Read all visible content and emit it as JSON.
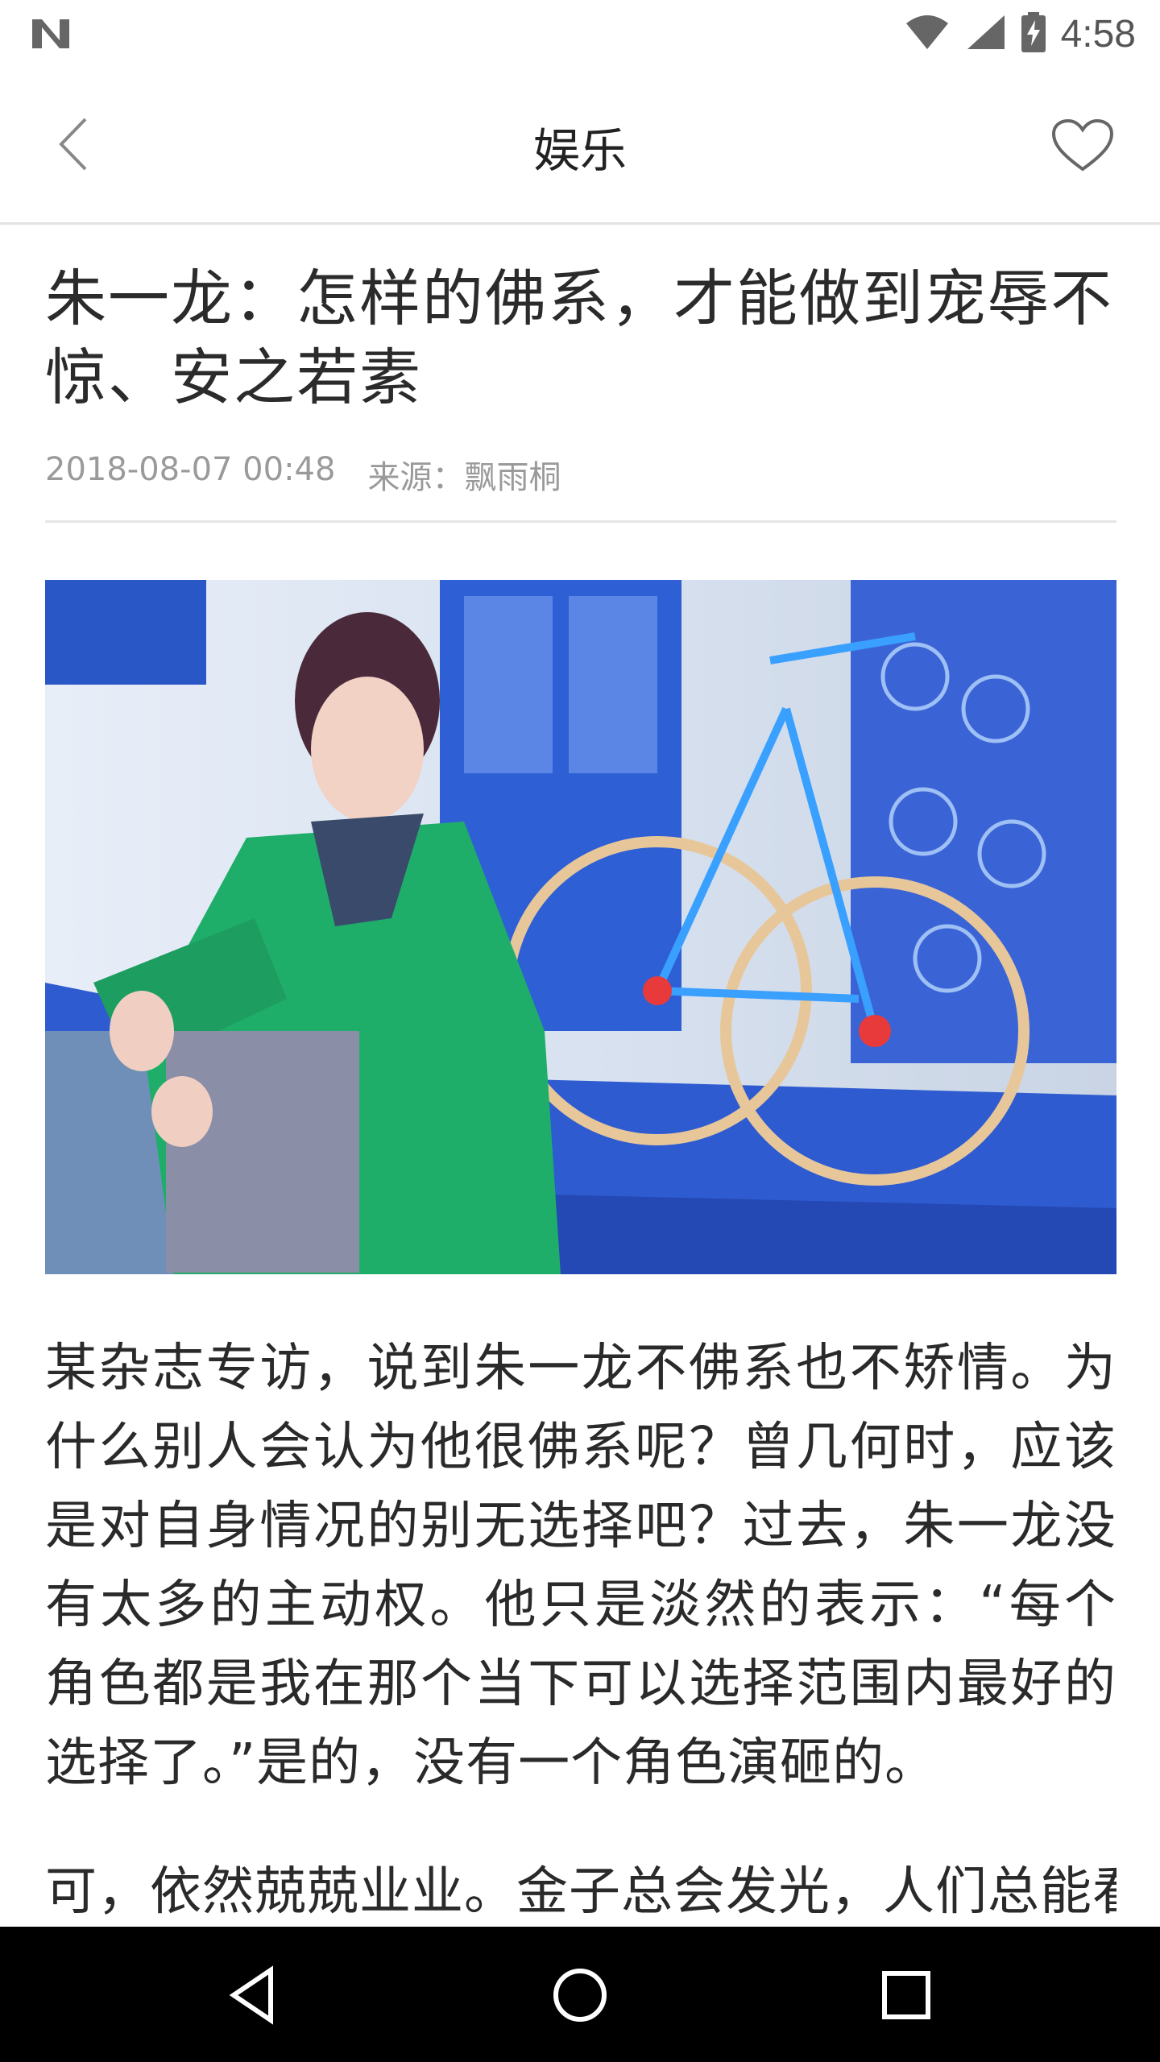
{
  "status_bar": {
    "time": "4:58",
    "icons": [
      "notification-n-icon",
      "wifi-icon",
      "signal-icon",
      "battery-charging-icon"
    ]
  },
  "header": {
    "title": "娱乐",
    "back_icon": "chevron-left-icon",
    "favorite_icon": "heart-outline-icon"
  },
  "article": {
    "title": "朱一龙：怎样的佛系，才能做到宠辱不惊、安之若素",
    "date": "2018-08-07 00:48",
    "source": "来源：飘雨桐",
    "paragraphs": [
      "某杂志专访，说到朱一龙不佛系也不矫情。为什么别人会认为他很佛系呢？曾几何时，应该是对自身情况的别无选择吧？过去，朱一龙没有太多的主动权。他只是淡然的表示：“每个角色都是我在那个当下可以选择范围内最好的选择了。”是的，没有一个角色演砸的。",
      "可，依然兢兢业业。金子总会发光，人们总能看"
    ]
  },
  "nav_bar": {
    "icons": [
      "back-triangle-icon",
      "home-circle-icon",
      "recents-square-icon"
    ]
  },
  "colors": {
    "status_bg": "#ffffff",
    "nav_bg": "#000000",
    "text": "#2a2a2a",
    "meta": "#9a9a9a",
    "divider": "#e6e6e6"
  }
}
